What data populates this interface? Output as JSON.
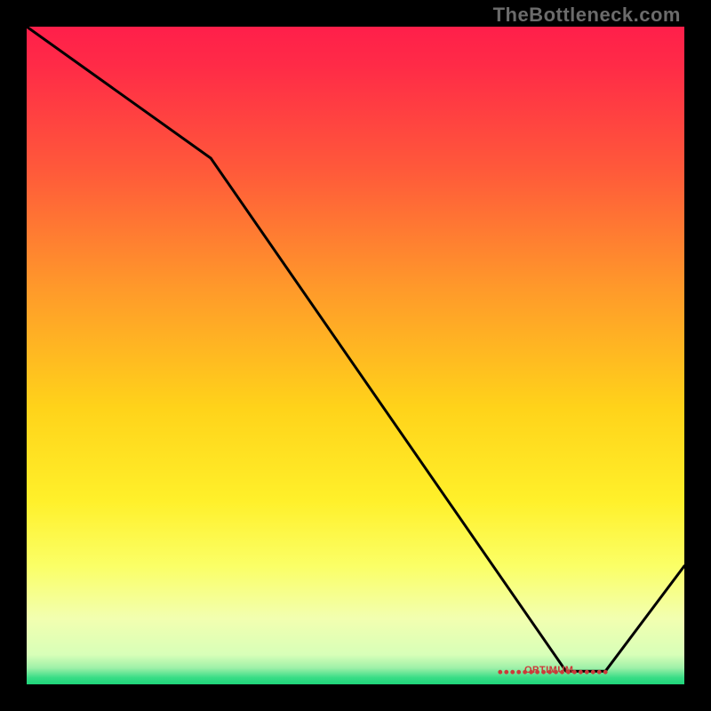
{
  "watermark": "TheBottleneck.com",
  "marker_label": "OPTIMUM",
  "chart_data": {
    "type": "line",
    "title": "",
    "xlabel": "",
    "ylabel": "",
    "xlim": [
      0,
      100
    ],
    "ylim": [
      0,
      100
    ],
    "x": [
      0,
      28,
      82,
      88,
      100
    ],
    "values": [
      100,
      80,
      2,
      2,
      18
    ],
    "gradient_stops": [
      {
        "pct": 0.0,
        "color": "#ff1f4a"
      },
      {
        "pct": 0.06,
        "color": "#ff2b47"
      },
      {
        "pct": 0.22,
        "color": "#ff5a3a"
      },
      {
        "pct": 0.4,
        "color": "#ff9a2a"
      },
      {
        "pct": 0.58,
        "color": "#ffd31a"
      },
      {
        "pct": 0.72,
        "color": "#fff02a"
      },
      {
        "pct": 0.82,
        "color": "#fbff66"
      },
      {
        "pct": 0.9,
        "color": "#f2ffb0"
      },
      {
        "pct": 0.955,
        "color": "#d8ffb8"
      },
      {
        "pct": 0.975,
        "color": "#9ef0a8"
      },
      {
        "pct": 0.99,
        "color": "#38dd86"
      },
      {
        "pct": 1.0,
        "color": "#1ed47a"
      }
    ],
    "marker": {
      "x_start": 72,
      "x_end": 88,
      "y": 2
    }
  }
}
